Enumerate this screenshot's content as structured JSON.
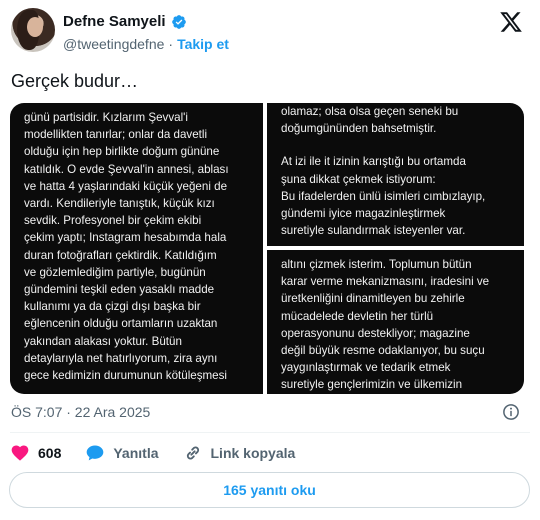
{
  "author": {
    "name": "Defne Samyeli",
    "handle": "@tweetingdefne",
    "separator": "·",
    "follow_label": "Takip et"
  },
  "tweet": {
    "text": "Gerçek budur…"
  },
  "media": {
    "left_panel": [
      "günü partisidir. Kızlarım Şevval'i",
      "modellikten tanırlar; onlar da davetli",
      "olduğu için hep birlikte doğum gününe",
      "katıldık. O evde Şevval'in annesi, ablası",
      "ve hatta 4 yaşlarındaki küçük yeğeni de",
      "vardı. Kendileriyle tanıştık, küçük kızı",
      "sevdik. Profesyonel bir çekim ekibi",
      "çekim yaptı; Instagram hesabımda hala",
      "duran fotoğrafları çektirdik. Katıldığım",
      "ve gözlemlediğim partiyle, bugünün",
      "gündemini teşkil eden yasaklı madde",
      "kullanımı ya da çizgi dışı başka bir",
      "eğlencenin olduğu ortamların uzaktan",
      "yakından alakası yoktur. Bütün",
      "detaylarıyla net hatırlıyorum, zira aynı",
      "gece kedimizin durumunun kötüleşmesi"
    ],
    "top_right_panel": [
      "olamaz; olsa olsa geçen seneki bu",
      "doğumgününden bahsetmiştir.",
      "",
      "At izi ile it izinin karıştığı bu ortamda",
      "şuna dikkat çekmek istiyorum:",
      "Bu ifadelerden ünlü isimleri cımbızlayıp,",
      "gündemi iyice magazinleştirmek",
      "suretiyle sulandırmak isteyenler var."
    ],
    "bottom_right_panel": [
      "altını çizmek isterim. Toplumun bütün",
      "karar verme mekanizmasını, iradesini ve",
      "üretkenliğini dinamitleyen bu zehirle",
      "mücadelede devletin her türlü",
      "operasyonunu destekliyor; magazine",
      "değil büyük resme odaklanıyor, bu suçu",
      "yaygınlaştırmak ve tedarik etmek",
      "suretiyle gençlerimizin ve ülkemizin"
    ]
  },
  "meta": {
    "time": "ÖS 7:07 · 22 Ara 2025"
  },
  "actions": {
    "likes": "608",
    "reply_label": "Yanıtla",
    "copy_link_label": "Link kopyala"
  },
  "read_replies_label": "165 yanıtı oku",
  "colors": {
    "accent": "#1d9bf0",
    "like": "#f91880",
    "text": "#0f1419",
    "muted": "#536471"
  }
}
